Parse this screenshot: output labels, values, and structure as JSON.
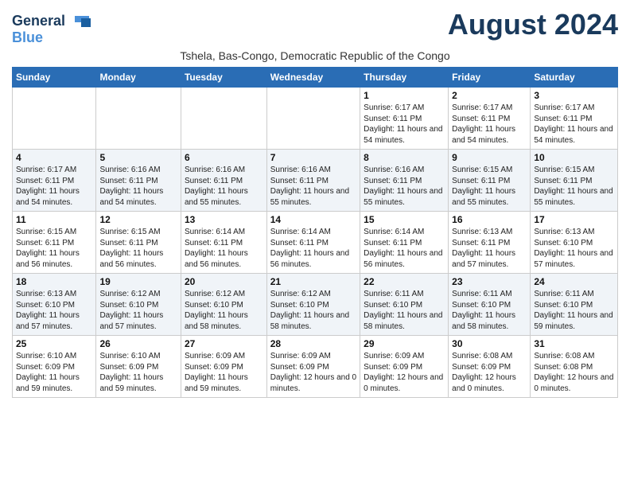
{
  "logo": {
    "general": "General",
    "blue": "Blue"
  },
  "title": "August 2024",
  "subtitle": "Tshela, Bas-Congo, Democratic Republic of the Congo",
  "headers": [
    "Sunday",
    "Monday",
    "Tuesday",
    "Wednesday",
    "Thursday",
    "Friday",
    "Saturday"
  ],
  "weeks": [
    [
      {
        "day": "",
        "sunrise": "",
        "sunset": "",
        "daylight": ""
      },
      {
        "day": "",
        "sunrise": "",
        "sunset": "",
        "daylight": ""
      },
      {
        "day": "",
        "sunrise": "",
        "sunset": "",
        "daylight": ""
      },
      {
        "day": "",
        "sunrise": "",
        "sunset": "",
        "daylight": ""
      },
      {
        "day": "1",
        "sunrise": "Sunrise: 6:17 AM",
        "sunset": "Sunset: 6:11 PM",
        "daylight": "Daylight: 11 hours and 54 minutes."
      },
      {
        "day": "2",
        "sunrise": "Sunrise: 6:17 AM",
        "sunset": "Sunset: 6:11 PM",
        "daylight": "Daylight: 11 hours and 54 minutes."
      },
      {
        "day": "3",
        "sunrise": "Sunrise: 6:17 AM",
        "sunset": "Sunset: 6:11 PM",
        "daylight": "Daylight: 11 hours and 54 minutes."
      }
    ],
    [
      {
        "day": "4",
        "sunrise": "Sunrise: 6:17 AM",
        "sunset": "Sunset: 6:11 PM",
        "daylight": "Daylight: 11 hours and 54 minutes."
      },
      {
        "day": "5",
        "sunrise": "Sunrise: 6:16 AM",
        "sunset": "Sunset: 6:11 PM",
        "daylight": "Daylight: 11 hours and 54 minutes."
      },
      {
        "day": "6",
        "sunrise": "Sunrise: 6:16 AM",
        "sunset": "Sunset: 6:11 PM",
        "daylight": "Daylight: 11 hours and 55 minutes."
      },
      {
        "day": "7",
        "sunrise": "Sunrise: 6:16 AM",
        "sunset": "Sunset: 6:11 PM",
        "daylight": "Daylight: 11 hours and 55 minutes."
      },
      {
        "day": "8",
        "sunrise": "Sunrise: 6:16 AM",
        "sunset": "Sunset: 6:11 PM",
        "daylight": "Daylight: 11 hours and 55 minutes."
      },
      {
        "day": "9",
        "sunrise": "Sunrise: 6:15 AM",
        "sunset": "Sunset: 6:11 PM",
        "daylight": "Daylight: 11 hours and 55 minutes."
      },
      {
        "day": "10",
        "sunrise": "Sunrise: 6:15 AM",
        "sunset": "Sunset: 6:11 PM",
        "daylight": "Daylight: 11 hours and 55 minutes."
      }
    ],
    [
      {
        "day": "11",
        "sunrise": "Sunrise: 6:15 AM",
        "sunset": "Sunset: 6:11 PM",
        "daylight": "Daylight: 11 hours and 56 minutes."
      },
      {
        "day": "12",
        "sunrise": "Sunrise: 6:15 AM",
        "sunset": "Sunset: 6:11 PM",
        "daylight": "Daylight: 11 hours and 56 minutes."
      },
      {
        "day": "13",
        "sunrise": "Sunrise: 6:14 AM",
        "sunset": "Sunset: 6:11 PM",
        "daylight": "Daylight: 11 hours and 56 minutes."
      },
      {
        "day": "14",
        "sunrise": "Sunrise: 6:14 AM",
        "sunset": "Sunset: 6:11 PM",
        "daylight": "Daylight: 11 hours and 56 minutes."
      },
      {
        "day": "15",
        "sunrise": "Sunrise: 6:14 AM",
        "sunset": "Sunset: 6:11 PM",
        "daylight": "Daylight: 11 hours and 56 minutes."
      },
      {
        "day": "16",
        "sunrise": "Sunrise: 6:13 AM",
        "sunset": "Sunset: 6:11 PM",
        "daylight": "Daylight: 11 hours and 57 minutes."
      },
      {
        "day": "17",
        "sunrise": "Sunrise: 6:13 AM",
        "sunset": "Sunset: 6:10 PM",
        "daylight": "Daylight: 11 hours and 57 minutes."
      }
    ],
    [
      {
        "day": "18",
        "sunrise": "Sunrise: 6:13 AM",
        "sunset": "Sunset: 6:10 PM",
        "daylight": "Daylight: 11 hours and 57 minutes."
      },
      {
        "day": "19",
        "sunrise": "Sunrise: 6:12 AM",
        "sunset": "Sunset: 6:10 PM",
        "daylight": "Daylight: 11 hours and 57 minutes."
      },
      {
        "day": "20",
        "sunrise": "Sunrise: 6:12 AM",
        "sunset": "Sunset: 6:10 PM",
        "daylight": "Daylight: 11 hours and 58 minutes."
      },
      {
        "day": "21",
        "sunrise": "Sunrise: 6:12 AM",
        "sunset": "Sunset: 6:10 PM",
        "daylight": "Daylight: 11 hours and 58 minutes."
      },
      {
        "day": "22",
        "sunrise": "Sunrise: 6:11 AM",
        "sunset": "Sunset: 6:10 PM",
        "daylight": "Daylight: 11 hours and 58 minutes."
      },
      {
        "day": "23",
        "sunrise": "Sunrise: 6:11 AM",
        "sunset": "Sunset: 6:10 PM",
        "daylight": "Daylight: 11 hours and 58 minutes."
      },
      {
        "day": "24",
        "sunrise": "Sunrise: 6:11 AM",
        "sunset": "Sunset: 6:10 PM",
        "daylight": "Daylight: 11 hours and 59 minutes."
      }
    ],
    [
      {
        "day": "25",
        "sunrise": "Sunrise: 6:10 AM",
        "sunset": "Sunset: 6:09 PM",
        "daylight": "Daylight: 11 hours and 59 minutes."
      },
      {
        "day": "26",
        "sunrise": "Sunrise: 6:10 AM",
        "sunset": "Sunset: 6:09 PM",
        "daylight": "Daylight: 11 hours and 59 minutes."
      },
      {
        "day": "27",
        "sunrise": "Sunrise: 6:09 AM",
        "sunset": "Sunset: 6:09 PM",
        "daylight": "Daylight: 11 hours and 59 minutes."
      },
      {
        "day": "28",
        "sunrise": "Sunrise: 6:09 AM",
        "sunset": "Sunset: 6:09 PM",
        "daylight": "Daylight: 12 hours and 0 minutes."
      },
      {
        "day": "29",
        "sunrise": "Sunrise: 6:09 AM",
        "sunset": "Sunset: 6:09 PM",
        "daylight": "Daylight: 12 hours and 0 minutes."
      },
      {
        "day": "30",
        "sunrise": "Sunrise: 6:08 AM",
        "sunset": "Sunset: 6:09 PM",
        "daylight": "Daylight: 12 hours and 0 minutes."
      },
      {
        "day": "31",
        "sunrise": "Sunrise: 6:08 AM",
        "sunset": "Sunset: 6:08 PM",
        "daylight": "Daylight: 12 hours and 0 minutes."
      }
    ]
  ]
}
